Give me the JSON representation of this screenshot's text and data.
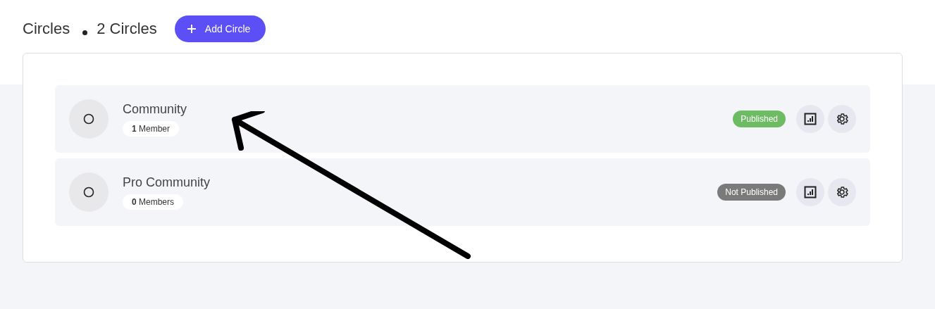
{
  "header": {
    "title": "Circles",
    "count": "2 Circles",
    "add_button": "Add Circle"
  },
  "circles": [
    {
      "name": "Community",
      "members": "**1** Member",
      "status": "Published",
      "published": true
    },
    {
      "name": "Pro Community",
      "members": "**0** Members",
      "status": "Not Published",
      "published": false
    }
  ]
}
